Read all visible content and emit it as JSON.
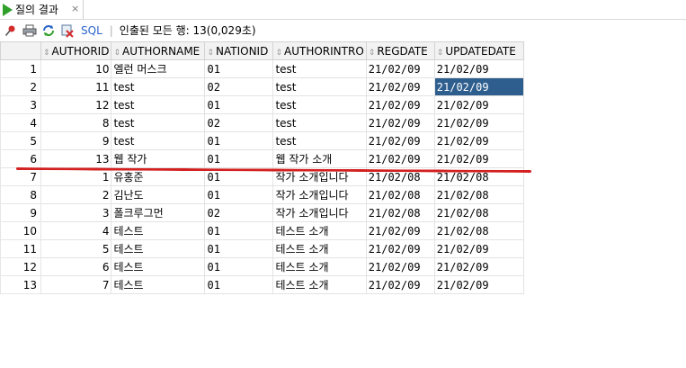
{
  "tab": {
    "title": "질의 결과",
    "close": "×"
  },
  "toolbar": {
    "sql_label": "SQL",
    "separator": "|",
    "status": "인출된 모든 행: 13(0,029초)"
  },
  "icons": [
    "pin-icon",
    "print-icon",
    "refresh-icon",
    "clear-icon"
  ],
  "columns": [
    "AUTHORID",
    "AUTHORNAME",
    "NATIONID",
    "AUTHORINTRO",
    "REGDATE",
    "UPDATEDATE"
  ],
  "rows": [
    {
      "num": "1",
      "authorid": "10",
      "authorname": "엘런 머스크",
      "nationid": "01",
      "authorintro": "test",
      "regdate": "21/02/09",
      "updatedate": "21/02/09"
    },
    {
      "num": "2",
      "authorid": "11",
      "authorname": "test",
      "nationid": "02",
      "authorintro": "test",
      "regdate": "21/02/09",
      "updatedate": "21/02/09"
    },
    {
      "num": "3",
      "authorid": "12",
      "authorname": "test",
      "nationid": "01",
      "authorintro": "test",
      "regdate": "21/02/09",
      "updatedate": "21/02/09"
    },
    {
      "num": "4",
      "authorid": "8",
      "authorname": "test",
      "nationid": "02",
      "authorintro": "test",
      "regdate": "21/02/09",
      "updatedate": "21/02/09"
    },
    {
      "num": "5",
      "authorid": "9",
      "authorname": "test",
      "nationid": "01",
      "authorintro": "test",
      "regdate": "21/02/09",
      "updatedate": "21/02/09"
    },
    {
      "num": "6",
      "authorid": "13",
      "authorname": "웹 작가",
      "nationid": "01",
      "authorintro": "웹 작가 소개",
      "regdate": "21/02/09",
      "updatedate": "21/02/09"
    },
    {
      "num": "7",
      "authorid": "1",
      "authorname": "유홍준",
      "nationid": "01",
      "authorintro": "작가 소개입니다",
      "regdate": "21/02/08",
      "updatedate": "21/02/08"
    },
    {
      "num": "8",
      "authorid": "2",
      "authorname": "김난도",
      "nationid": "01",
      "authorintro": "작가 소개입니다",
      "regdate": "21/02/08",
      "updatedate": "21/02/08"
    },
    {
      "num": "9",
      "authorid": "3",
      "authorname": "폴크루그먼",
      "nationid": "02",
      "authorintro": "작가 소개입니다",
      "regdate": "21/02/08",
      "updatedate": "21/02/08"
    },
    {
      "num": "10",
      "authorid": "4",
      "authorname": "테스트",
      "nationid": "01",
      "authorintro": "테스트 소개",
      "regdate": "21/02/09",
      "updatedate": "21/02/08"
    },
    {
      "num": "11",
      "authorid": "5",
      "authorname": "테스트",
      "nationid": "01",
      "authorintro": "테스트 소개",
      "regdate": "21/02/09",
      "updatedate": "21/02/09"
    },
    {
      "num": "12",
      "authorid": "6",
      "authorname": "테스트",
      "nationid": "01",
      "authorintro": "테스트 소개",
      "regdate": "21/02/09",
      "updatedate": "21/02/09"
    },
    {
      "num": "13",
      "authorid": "7",
      "authorname": "테스트",
      "nationid": "01",
      "authorintro": "테스트 소개",
      "regdate": "21/02/09",
      "updatedate": "21/02/09"
    }
  ],
  "selected_cell": {
    "row": 2,
    "column": "UPDATEDATE"
  },
  "colors": {
    "selection": "#2e5e8e",
    "annotation_line": "#d32020",
    "sql_link": "#2a64c9",
    "run_icon": "#2fa12b"
  }
}
